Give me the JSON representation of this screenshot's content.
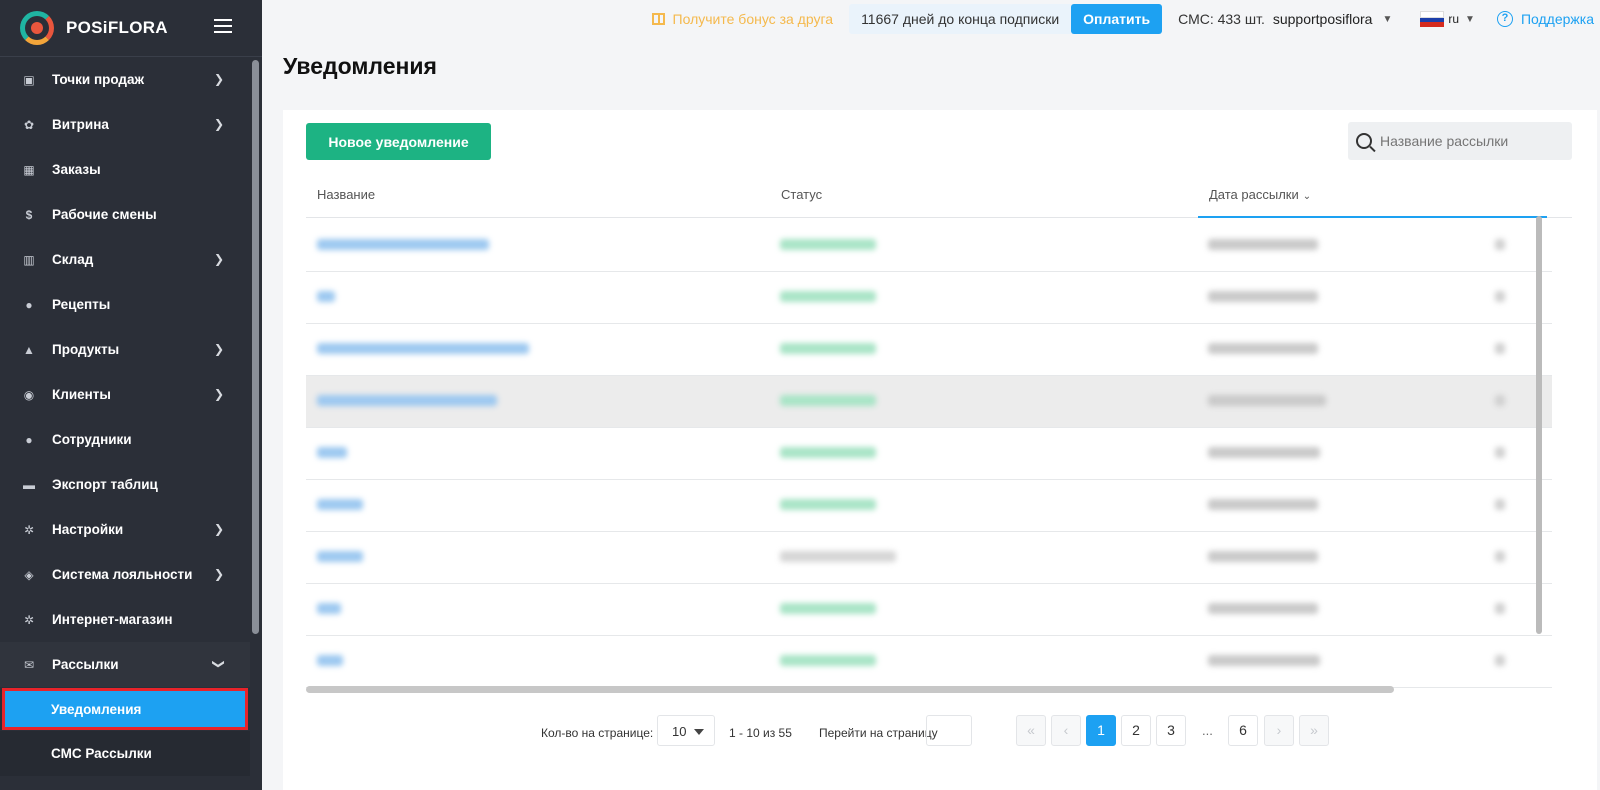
{
  "brand": {
    "name": "POSiFLORA"
  },
  "topbar": {
    "bonus": "Получите бонус за друга",
    "subscription": "11667 дней до конца подписки",
    "pay_label": "Оплатить",
    "sms": "СМС: 433 шт.",
    "user": "supportposiflora",
    "lang": "ru",
    "help": "Поддержка"
  },
  "sidebar": {
    "items": [
      {
        "label": "Точки продаж",
        "icon": "store-icon"
      },
      {
        "label": "Витрина",
        "icon": "flower-icon"
      },
      {
        "label": "Заказы",
        "icon": "calendar-icon"
      },
      {
        "label": "Рабочие смены",
        "icon": "dollar-icon"
      },
      {
        "label": "Склад",
        "icon": "warehouse-icon"
      },
      {
        "label": "Рецепты",
        "icon": "recipe-icon"
      },
      {
        "label": "Продукты",
        "icon": "basket-icon"
      },
      {
        "label": "Клиенты",
        "icon": "client-icon"
      },
      {
        "label": "Сотрудники",
        "icon": "person-icon"
      },
      {
        "label": "Экспорт таблиц",
        "icon": "folder-icon"
      },
      {
        "label": "Настройки",
        "icon": "gear-icon"
      },
      {
        "label": "Система лояльности",
        "icon": "tag-icon"
      },
      {
        "label": "Интернет-магазин",
        "icon": "gear-icon"
      },
      {
        "label": "Рассылки",
        "icon": "mail-icon"
      }
    ],
    "subitems": [
      {
        "label": "Уведомления"
      },
      {
        "label": "СМС Рассылки"
      }
    ]
  },
  "page": {
    "title": "Уведомления"
  },
  "toolbar": {
    "new_label": "Новое уведомление",
    "search_placeholder": "Название рассылки"
  },
  "table": {
    "columns": [
      "Название",
      "Статус",
      "Дата рассылки"
    ]
  },
  "pager": {
    "per_page_label": "Кол-во на странице:",
    "per_page": "10",
    "range": "1 - 10 из 55",
    "goto_label": "Перейти на страницу",
    "first": "«",
    "prev": "‹",
    "pages": [
      "1",
      "2",
      "3",
      "6"
    ],
    "ellipsis": "...",
    "next": "›",
    "last": "»"
  },
  "colors": {
    "accent": "#1da1f2",
    "primary_button": "#1db383",
    "sidebar": "#2b2f38",
    "bonus": "#f5b94d"
  }
}
